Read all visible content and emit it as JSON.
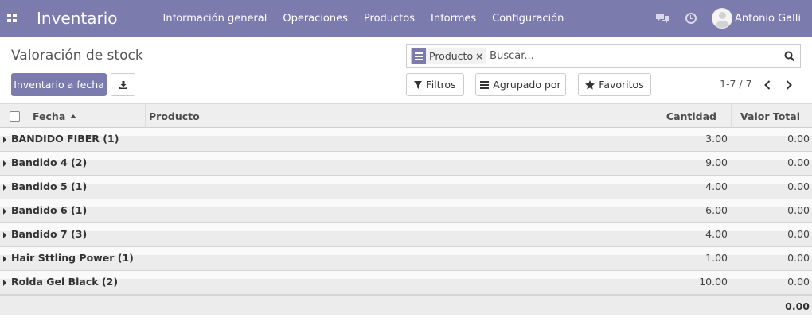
{
  "navbar": {
    "brand": "Inventario",
    "menu": [
      "Información general",
      "Operaciones",
      "Productos",
      "Informes",
      "Configuración"
    ],
    "user": "Antonio Galli",
    "icons": [
      "apps-icon",
      "chat-icon",
      "clock-icon",
      "avatar"
    ],
    "color": "#7c7bad"
  },
  "control_panel": {
    "title": "Valoración de stock",
    "primary_button": "Inventario a fecha",
    "download_icon": "download-icon",
    "search": {
      "facet_label": "Producto",
      "facet_remove": "×",
      "placeholder": "Buscar..."
    },
    "filters": {
      "filtros": "Filtros",
      "agrupado": "Agrupado por",
      "favoritos": "Favoritos"
    },
    "pager": {
      "value": "1-7 / 7"
    }
  },
  "table": {
    "columns": {
      "fecha": "Fecha",
      "producto": "Producto",
      "cantidad": "Cantidad",
      "valor_total": "Valor Total"
    },
    "groups": [
      {
        "name": "BANDIDO FIBER (1)",
        "cantidad": "3.00",
        "valor": "0.00"
      },
      {
        "name": "Bandido 4 (2)",
        "cantidad": "9.00",
        "valor": "0.00"
      },
      {
        "name": "Bandido 5 (1)",
        "cantidad": "4.00",
        "valor": "0.00"
      },
      {
        "name": "Bandido 6 (1)",
        "cantidad": "6.00",
        "valor": "0.00"
      },
      {
        "name": "Bandido 7 (3)",
        "cantidad": "4.00",
        "valor": "0.00"
      },
      {
        "name": "Hair Sttling Power (1)",
        "cantidad": "1.00",
        "valor": "0.00"
      },
      {
        "name": "Rolda Gel Black (2)",
        "cantidad": "10.00",
        "valor": "0.00"
      }
    ],
    "total_valor": "0.00"
  }
}
